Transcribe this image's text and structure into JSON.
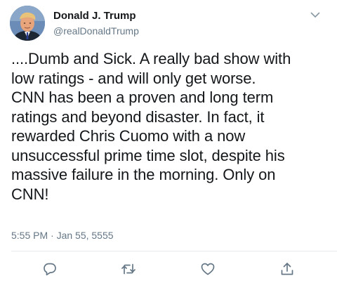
{
  "user": {
    "name": "Donald J. Trump",
    "handle": "@realDonaldTrump"
  },
  "tweet": {
    "lines": [
      "....Dumb and Sick. A really bad show with",
      "low ratings - and will only get worse.",
      "CNN has been a proven and long term",
      "ratings and beyond disaster. In fact, it",
      "rewarded Chris Cuomo with a now",
      "unsuccessful prime time slot, despite his",
      "massive failure in the morning. Only on",
      "CNN!"
    ],
    "timestamp": "5:55 PM · Jan 55, 5555"
  },
  "icons": {
    "menu": "chevron-down-icon",
    "reply": "reply-icon",
    "retweet": "retweet-icon",
    "like": "heart-icon",
    "share": "share-icon"
  },
  "colors": {
    "text": "#14171a",
    "secondary": "#657786",
    "divider": "#e6ecf0",
    "icon": "#657786"
  }
}
